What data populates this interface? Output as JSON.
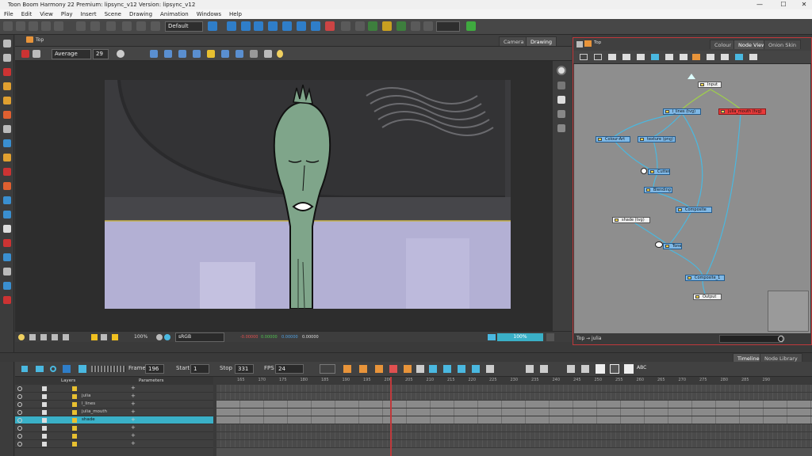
{
  "window": {
    "title": "Toon Boom Harmony 22 Premium: lipsync_v12 Version: lipsync_v12",
    "min": "—",
    "max": "☐",
    "close": "✕"
  },
  "menu": [
    "File",
    "Edit",
    "View",
    "Play",
    "Insert",
    "Scene",
    "Drawing",
    "Animation",
    "Windows",
    "Help"
  ],
  "toolbar": {
    "workspace": "Default"
  },
  "camera_view": {
    "breadcrumb": "Top",
    "tabs": [
      "Camera",
      "Drawing"
    ],
    "brush_mode": "Average",
    "brush_size": "29",
    "zoom": "100%",
    "color_space": "sRGB",
    "coords": {
      "x": "-0.00000",
      "y": "0.00000",
      "z": "0.00000",
      "w": "0.00000"
    },
    "progress_label": "100%"
  },
  "node_view": {
    "breadcrumb": "Top",
    "tabs": [
      "Colour",
      "Node View",
      "Onion Skin"
    ],
    "footer_path": "Top → julia",
    "nodes": {
      "input": "Input",
      "lines": "l_lines (tvg)",
      "mouth": "julia_mouth (tvg)",
      "colour_art": "Colour-Art",
      "texture": "texture (png)",
      "cutter": "Cutter",
      "blending": "Blending",
      "composite": "Composite",
      "shade": "shade (tvg)",
      "tone": "Tone",
      "composite1": "Composite_1",
      "output": "Output"
    }
  },
  "timeline": {
    "tabs": [
      "Timeline",
      "Node Library"
    ],
    "frame_label": "Frame",
    "frame": "196",
    "start_label": "Start",
    "start": "1",
    "stop_label": "Stop",
    "stop": "331",
    "fps_label": "FPS",
    "fps": "24",
    "columns": {
      "layers": "Layers",
      "parameters": "Parameters"
    },
    "ruler": [
      "165",
      "170",
      "175",
      "180",
      "185",
      "190",
      "195",
      "200",
      "205",
      "210",
      "215",
      "220",
      "225",
      "230",
      "235",
      "240",
      "245",
      "250",
      "255",
      "260",
      "265",
      "270",
      "275",
      "280",
      "285",
      "290"
    ],
    "layers": [
      {
        "name": "",
        "color": "#c0392b",
        "selected": false
      },
      {
        "name": "julia",
        "color": "#cccccc",
        "selected": false
      },
      {
        "name": "l_lines",
        "color": "#cccccc",
        "selected": false
      },
      {
        "name": "julia_mouth",
        "color": "#cccccc",
        "selected": false
      },
      {
        "name": "shade",
        "color": "#111111",
        "selected": true
      },
      {
        "name": "",
        "color": "#c0392b",
        "selected": false
      },
      {
        "name": "",
        "color": "#c0392b",
        "selected": false
      },
      {
        "name": "",
        "color": "#c0392b",
        "selected": false
      }
    ]
  }
}
